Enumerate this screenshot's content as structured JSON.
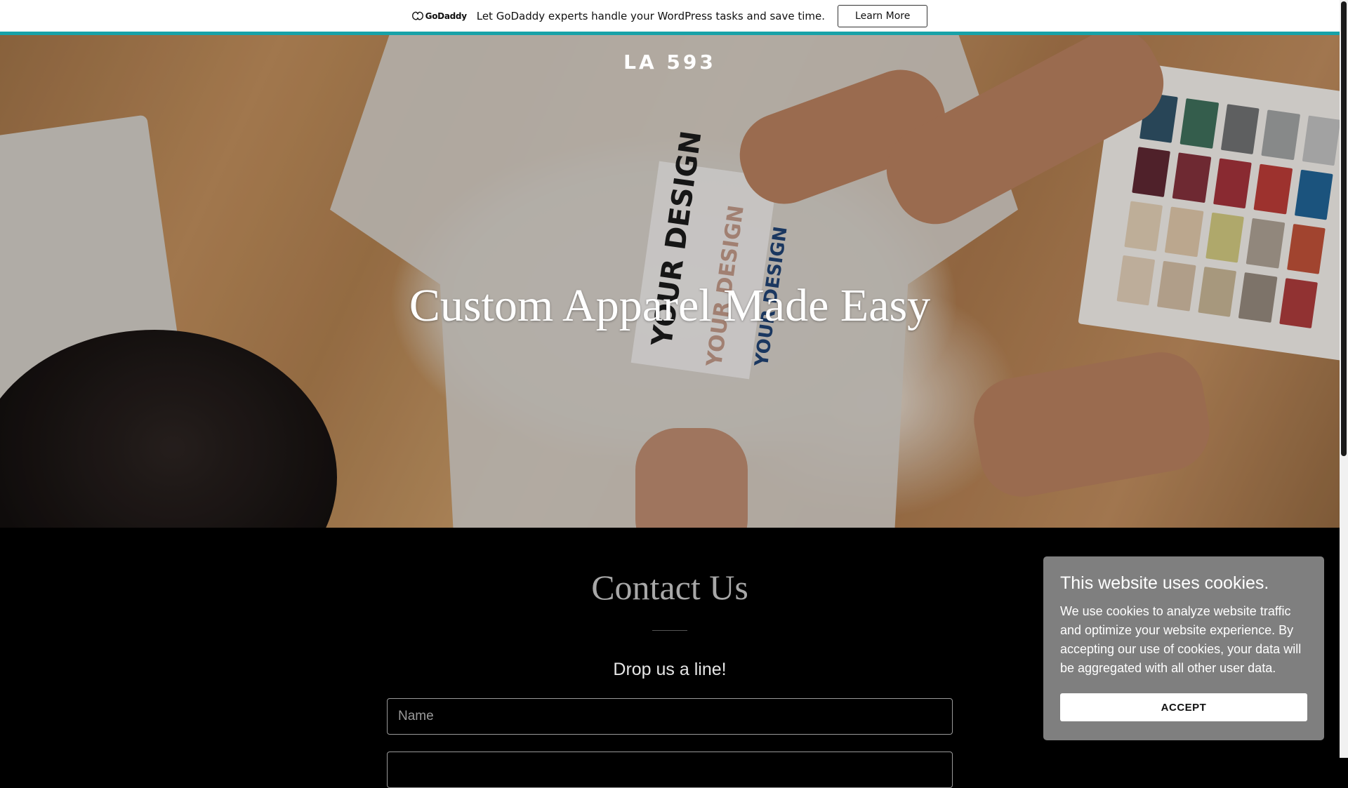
{
  "promo": {
    "logo_text": "GoDaddy",
    "message": "Let GoDaddy experts handle your WordPress tasks and save time.",
    "button_label": "Learn More",
    "accent_color": "#17a2a8"
  },
  "hero": {
    "brand": "LA 593",
    "title": "Custom Apparel Made Easy",
    "image_text": [
      "YOUR DESIGN",
      "YOUR DESIGN",
      "YOUR DESIGN"
    ]
  },
  "contact": {
    "title": "Contact Us",
    "subtitle": "Drop us a line!",
    "name_placeholder": "Name"
  },
  "cookie": {
    "title": "This website uses cookies.",
    "body": "We use cookies to analyze website traffic and optimize your website experience. By accepting our use of cookies, your data will be aggregated with all other user data.",
    "accept_label": "ACCEPT"
  }
}
